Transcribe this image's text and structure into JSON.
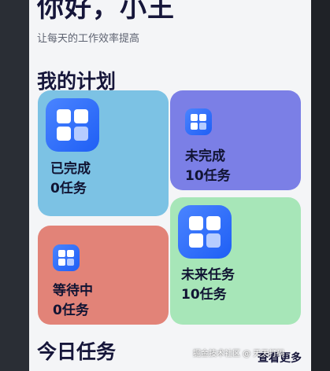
{
  "greeting": "你好，小王",
  "subtitle": "让每天的工作效率提高",
  "plan": {
    "title": "我的计划",
    "cards": [
      {
        "status": "已完成",
        "count": "0任务",
        "color": "#7cc2e4"
      },
      {
        "status": "未完成",
        "count": "10任务",
        "color": "#7b7fe6"
      },
      {
        "status": "等待中",
        "count": "0任务",
        "color": "#e28378"
      },
      {
        "status": "未来任务",
        "count": "10任务",
        "color": "#a7e6b8"
      }
    ]
  },
  "today": {
    "title": "今日任务",
    "view_more": "查看更多"
  },
  "watermark": "掘金技术社区 @ 天天打码"
}
